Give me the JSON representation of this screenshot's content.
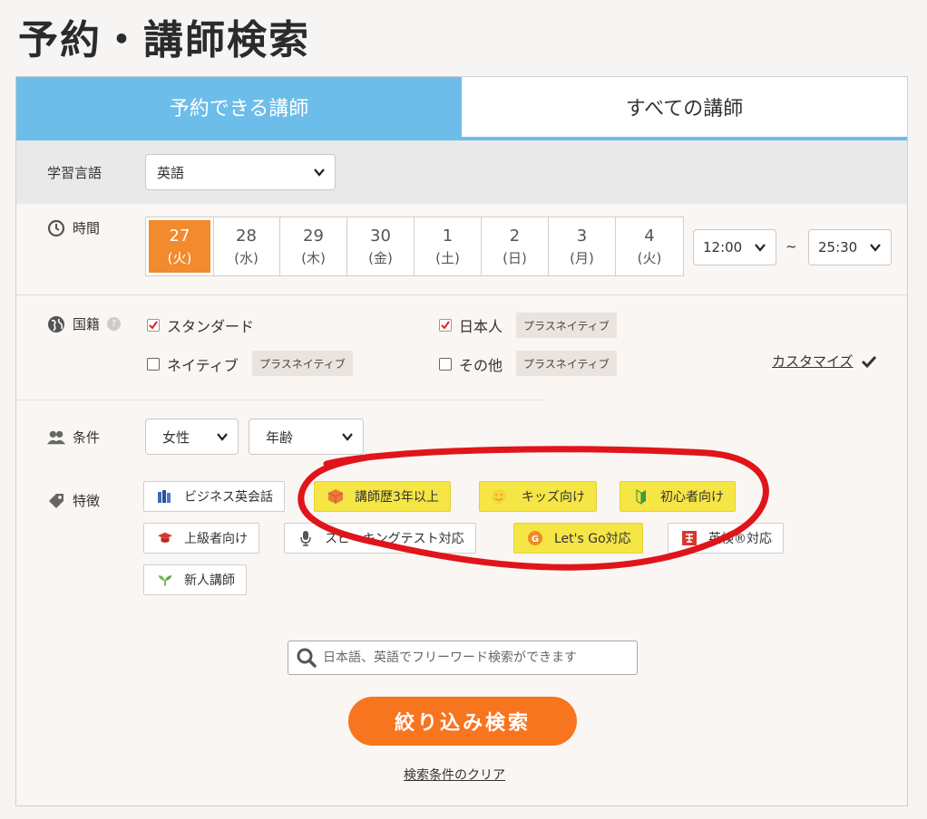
{
  "page_title": "予約・講師検索",
  "tabs": [
    {
      "label": "予約できる講師",
      "active": true
    },
    {
      "label": "すべての講師",
      "active": false
    }
  ],
  "language": {
    "label": "学習言語",
    "selected": "英語"
  },
  "time": {
    "label": "時間",
    "dates": [
      {
        "day": "27",
        "dow": "(火)",
        "selected": true
      },
      {
        "day": "28",
        "dow": "(水)"
      },
      {
        "day": "29",
        "dow": "(木)"
      },
      {
        "day": "30",
        "dow": "(金)"
      },
      {
        "day": "1",
        "dow": "(土)"
      },
      {
        "day": "2",
        "dow": "(日)"
      },
      {
        "day": "3",
        "dow": "(月)"
      },
      {
        "day": "4",
        "dow": "(火)"
      }
    ],
    "from": "12:00",
    "separator": "~",
    "to": "25:30"
  },
  "nationality": {
    "label": "国籍",
    "options": [
      {
        "label": "スタンダード",
        "checked": true
      },
      {
        "label": "日本人",
        "checked": true,
        "badge": "プラスネイティブ"
      },
      {
        "label": "ネイティブ",
        "checked": false,
        "badge": "プラスネイティブ"
      },
      {
        "label": "その他",
        "checked": false,
        "badge": "プラスネイティブ"
      }
    ],
    "customize": "カスタマイズ"
  },
  "conditions": {
    "label": "条件",
    "gender": "女性",
    "age": "年齢"
  },
  "features": {
    "label": "特徴",
    "items": [
      {
        "label": "ビジネス英会話",
        "highlight": false,
        "icon": "book-icon"
      },
      {
        "label": "講師歴3年以上",
        "highlight": true,
        "icon": "cube-icon"
      },
      {
        "label": "キッズ向け",
        "highlight": true,
        "icon": "smile-icon"
      },
      {
        "label": "初心者向け",
        "highlight": true,
        "icon": "beginner-leaf-icon"
      },
      {
        "label": "上級者向け",
        "highlight": false,
        "icon": "graduation-cap-icon"
      },
      {
        "label": "スピーキングテスト対応",
        "highlight": false,
        "icon": "microphone-icon"
      },
      {
        "label": "Let's Go対応",
        "highlight": true,
        "icon": "letsgo-icon"
      },
      {
        "label": "英検®対応",
        "highlight": false,
        "icon": "eiken-icon"
      },
      {
        "label": "新人講師",
        "highlight": false,
        "icon": "sprout-icon"
      }
    ]
  },
  "search": {
    "placeholder": "日本語、英語でフリーワード検索ができます"
  },
  "submit_label": "絞り込み検索",
  "clear_label": "検索条件のクリア",
  "colors": {
    "accent_blue": "#6cbde9",
    "accent_orange": "#f7751e",
    "date_selected": "#f28a2e",
    "feature_yellow": "#f5e545",
    "annotation_red": "#e0151b"
  }
}
